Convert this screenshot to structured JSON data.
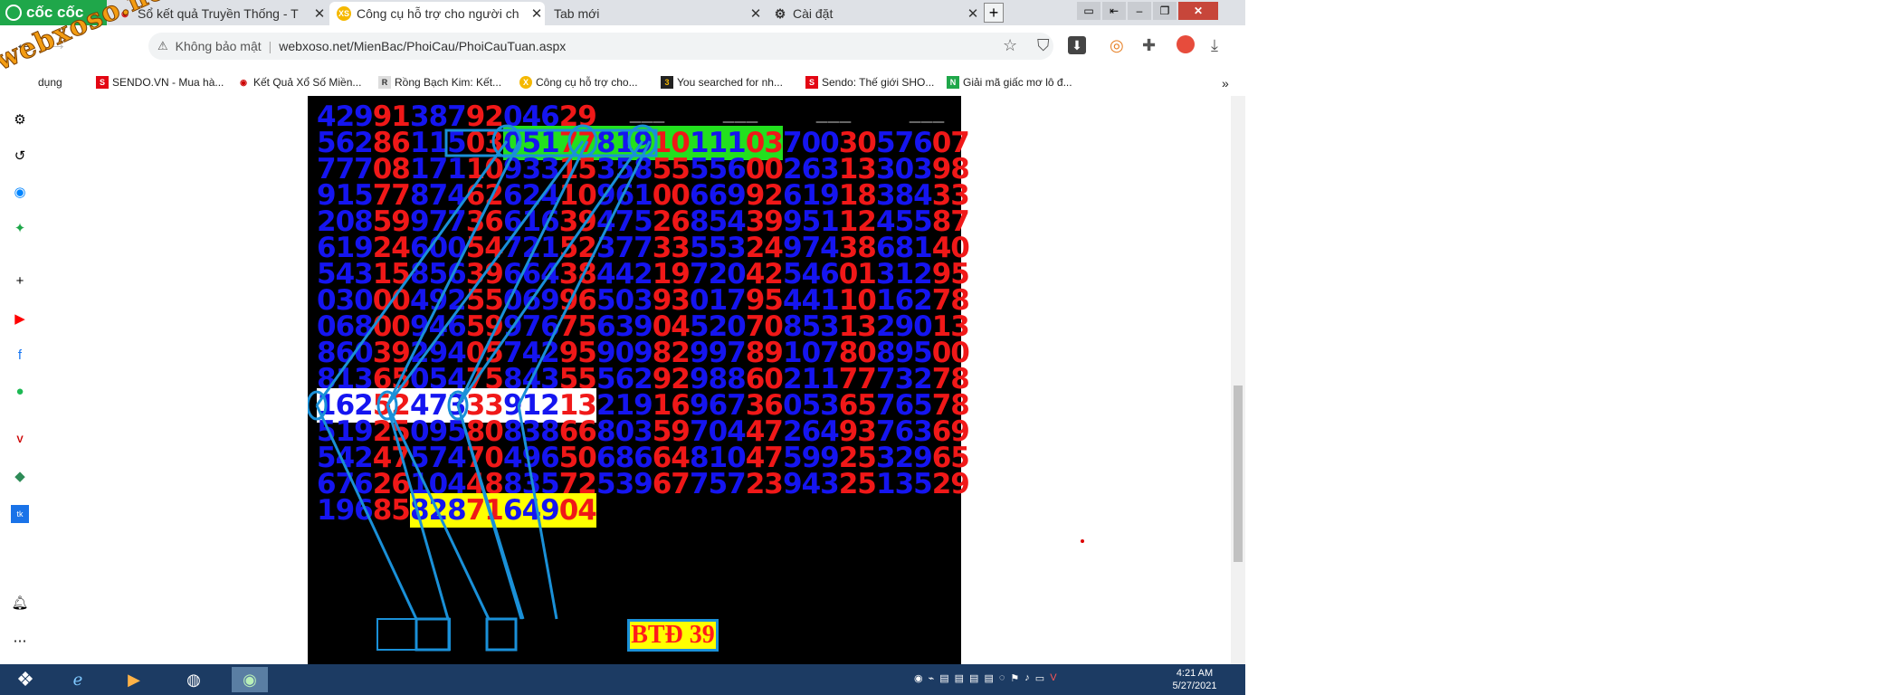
{
  "browser": {
    "brand": "cốc cốc",
    "tabs": [
      {
        "label": "Sổ kết quả Truyền Thống - T",
        "active": false
      },
      {
        "label": "Công cụ hỗ trợ cho người ch",
        "active": true
      },
      {
        "label": "Tab mới",
        "active": false
      },
      {
        "label": "Cài đặt",
        "active": false
      }
    ],
    "security_label": "Không bảo mật",
    "url": "webxoso.net/MienBac/PhoiCau/PhoiCauTuan.aspx",
    "bookmarks": [
      "dụng",
      "SENDO.VN - Mua hà...",
      "Kết Quả Xổ Số Miền...",
      "Rồng Bạch Kim: Kết...",
      "Công cụ hỗ trợ cho...",
      "You searched for nh...",
      "Sendo: Thế giới SHO...",
      "Giải mã giấc mơ lô đ..."
    ],
    "watermark": "webxoso.net"
  },
  "board": {
    "rows": [
      [
        "42991",
        "38792",
        "04629",
        "—",
        "—",
        "—",
        "—"
      ],
      [
        "56286",
        "11503",
        "05177",
        "81910",
        "11103",
        "70030",
        "57607"
      ],
      [
        "77708",
        "17110",
        "93315",
        "35855",
        "55600",
        "26313",
        "30398"
      ],
      [
        "91577",
        "87462",
        "62410",
        "96100",
        "66992",
        "61918",
        "38433"
      ],
      [
        "20859",
        "97736",
        "61639",
        "47526",
        "85439",
        "95112",
        "45587"
      ],
      [
        "61924",
        "60054",
        "72152",
        "37733",
        "55324",
        "97438",
        "68140"
      ],
      [
        "54315",
        "85639",
        "66438",
        "44219",
        "72042",
        "54601",
        "31295"
      ],
      [
        "03000",
        "49255",
        "06996",
        "50393",
        "01795",
        "44110",
        "16278"
      ],
      [
        "06800",
        "94659",
        "97675",
        "63904",
        "52070",
        "85313",
        "29013"
      ],
      [
        "86039",
        "29405",
        "74295",
        "90982",
        "99789",
        "10780",
        "89500"
      ],
      [
        "81365",
        "05475",
        "84355",
        "56292",
        "98860",
        "21177",
        "73278"
      ],
      [
        "16252",
        "47333",
        "91213",
        "21916",
        "96736",
        "05365",
        "76578"
      ],
      [
        "51925",
        "09580",
        "83866",
        "80359",
        "70447",
        "26493",
        "76369"
      ],
      [
        "54247",
        "57470",
        "49650",
        "68664",
        "81047",
        "59925",
        "32965"
      ],
      [
        "67626",
        "10448",
        "83572",
        "53967",
        "75723",
        "94325",
        "13529"
      ],
      [
        "19685",
        "82871",
        "64904"
      ]
    ],
    "result_label": "BTĐ 39"
  },
  "taskbar": {
    "time": "4:21 AM",
    "date": "5/27/2021"
  },
  "colors": {
    "digit_blue": "#1515f0",
    "digit_red": "#f01818",
    "highlight_green": "#22e01e",
    "highlight_yellow": "#ffff00",
    "line_blue": "#1a90d8"
  }
}
